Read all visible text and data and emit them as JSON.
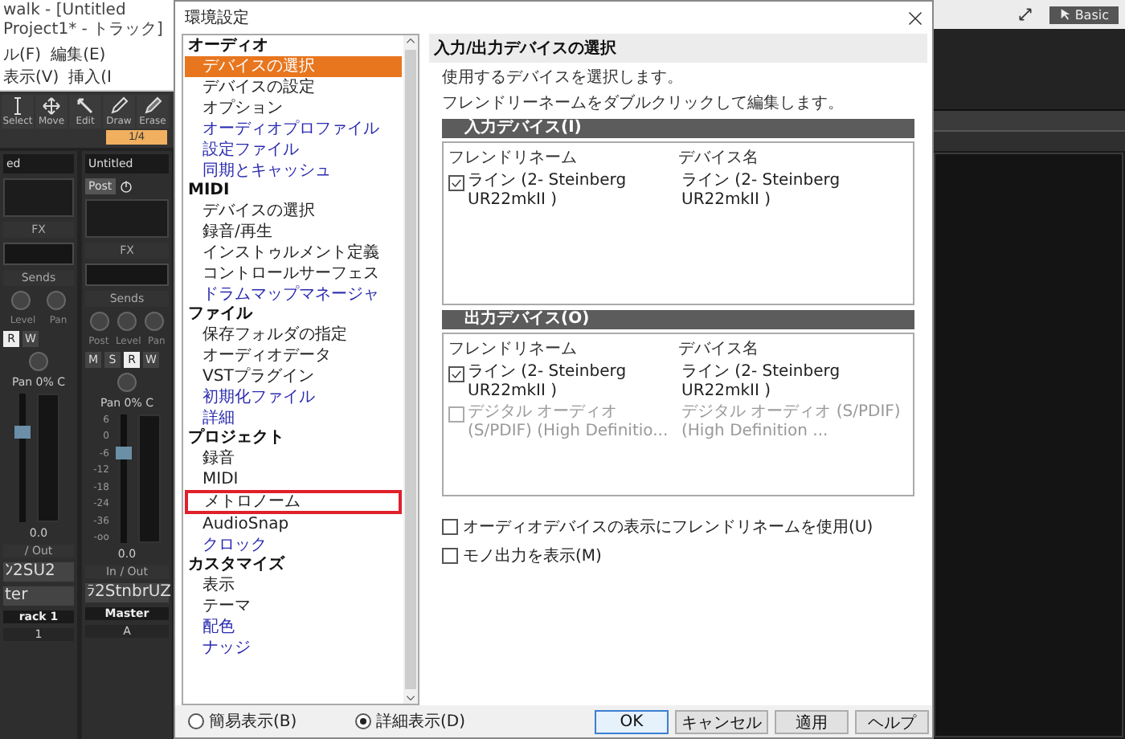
{
  "app": {
    "title": "walk - [Untitled Project1* - トラック]",
    "menu": [
      "ル(F)",
      "編集(E)",
      "表示(V)",
      "挿入(I"
    ],
    "tools": [
      {
        "label": "Select",
        "kind": "ibeam"
      },
      {
        "label": "Move",
        "kind": "move"
      },
      {
        "label": "Edit",
        "kind": "edit"
      },
      {
        "label": "Draw",
        "kind": "draw"
      },
      {
        "label": "Erase",
        "kind": "erase"
      }
    ],
    "snap": "1/4",
    "strips": [
      {
        "name": "ed",
        "fx": "FX",
        "sends": "Sends",
        "send_labels": [
          "Level",
          "Pan"
        ],
        "buttons": [
          {
            "label": "R",
            "on": true
          },
          {
            "label": "W",
            "on": false
          }
        ],
        "pan": "Pan 0% C",
        "value": "0.0",
        "io": "/ Out",
        "input": "ﾝ2SU2",
        "output": "ter",
        "label": "rack 1",
        "number": "1"
      },
      {
        "name": "Untitled",
        "post": "Post",
        "fx": "FX",
        "sends": "Sends",
        "send_labels": [
          "Post",
          "Level",
          "Pan"
        ],
        "buttons": [
          {
            "label": "M",
            "on": false
          },
          {
            "label": "S",
            "on": false
          },
          {
            "label": "R",
            "on": true
          },
          {
            "label": "W",
            "on": false
          }
        ],
        "pan": "Pan 0% C",
        "scale": [
          "6",
          "0",
          "-6",
          "-12",
          "-18",
          "-24",
          "-36",
          "-oo"
        ],
        "value": "0.0",
        "io": "In / Out",
        "input": "ﾗ2StnbrUZ",
        "label": "Master",
        "number": "A"
      }
    ],
    "workspace": "Basic"
  },
  "dialog": {
    "title": "環境設定",
    "tree": [
      {
        "label": "オーディオ",
        "children": [
          {
            "label": "デバイスの選択",
            "selected": true,
            "advanced": false,
            "highlighted": false
          },
          {
            "label": "デバイスの設定",
            "selected": false,
            "advanced": false,
            "highlighted": false
          },
          {
            "label": "オプション",
            "selected": false,
            "advanced": false,
            "highlighted": false
          },
          {
            "label": "オーディオプロファイル",
            "selected": false,
            "advanced": true,
            "highlighted": false
          },
          {
            "label": "設定ファイル",
            "selected": false,
            "advanced": true,
            "highlighted": false
          },
          {
            "label": "同期とキャッシュ",
            "selected": false,
            "advanced": true,
            "highlighted": false
          }
        ]
      },
      {
        "label": "MIDI",
        "children": [
          {
            "label": "デバイスの選択",
            "selected": false,
            "advanced": false,
            "highlighted": false
          },
          {
            "label": "録音/再生",
            "selected": false,
            "advanced": false,
            "highlighted": false
          },
          {
            "label": "インストゥルメント定義",
            "selected": false,
            "advanced": false,
            "highlighted": false
          },
          {
            "label": "コントロールサーフェス",
            "selected": false,
            "advanced": false,
            "highlighted": false
          },
          {
            "label": "ドラムマップマネージャ",
            "selected": false,
            "advanced": true,
            "highlighted": false
          }
        ]
      },
      {
        "label": "ファイル",
        "children": [
          {
            "label": "保存フォルダの指定",
            "selected": false,
            "advanced": false,
            "highlighted": false
          },
          {
            "label": "オーディオデータ",
            "selected": false,
            "advanced": false,
            "highlighted": false
          },
          {
            "label": "VSTプラグイン",
            "selected": false,
            "advanced": false,
            "highlighted": false
          },
          {
            "label": "初期化ファイル",
            "selected": false,
            "advanced": true,
            "highlighted": false
          },
          {
            "label": "詳細",
            "selected": false,
            "advanced": true,
            "highlighted": false
          }
        ]
      },
      {
        "label": "プロジェクト",
        "children": [
          {
            "label": "録音",
            "selected": false,
            "advanced": false,
            "highlighted": false
          },
          {
            "label": "MIDI",
            "selected": false,
            "advanced": false,
            "highlighted": false
          },
          {
            "label": "メトロノーム",
            "selected": false,
            "advanced": false,
            "highlighted": true
          },
          {
            "label": "AudioSnap",
            "selected": false,
            "advanced": false,
            "highlighted": false
          },
          {
            "label": "クロック",
            "selected": false,
            "advanced": true,
            "highlighted": false
          }
        ]
      },
      {
        "label": "カスタマイズ",
        "children": [
          {
            "label": "表示",
            "selected": false,
            "advanced": false,
            "highlighted": false
          },
          {
            "label": "テーマ",
            "selected": false,
            "advanced": false,
            "highlighted": false
          },
          {
            "label": "配色",
            "selected": false,
            "advanced": true,
            "highlighted": false
          },
          {
            "label": "ナッジ",
            "selected": false,
            "advanced": true,
            "highlighted": false
          }
        ]
      }
    ],
    "panel": {
      "title": "入力/出力デバイスの選択",
      "description": [
        "使用するデバイスを選択します。",
        "フレンドリーネームをダブルクリックして編集します。"
      ],
      "sections": [
        {
          "title": "入力デバイス(I)",
          "columns": [
            "フレンドリネーム",
            "デバイス名"
          ],
          "rows": [
            {
              "checked": true,
              "disabled": false,
              "cells": [
                "ライン (2- Steinberg UR22mkII )",
                "ライン (2- Steinberg UR22mkII )"
              ]
            }
          ]
        },
        {
          "title": "出力デバイス(O)",
          "columns": [
            "フレンドリネーム",
            "デバイス名"
          ],
          "rows": [
            {
              "checked": true,
              "disabled": false,
              "cells": [
                "ライン (2- Steinberg UR22mkII )",
                "ライン (2- Steinberg UR22mkII )"
              ]
            },
            {
              "checked": false,
              "disabled": true,
              "cells": [
                "デジタル オーディオ (S/PDIF) (High Definitio...",
                "デジタル オーディオ (S/PDIF) (High Definition ..."
              ]
            }
          ]
        }
      ],
      "options": [
        {
          "label": "オーディオデバイスの表示にフレンドリネームを使用(U)",
          "checked": false
        },
        {
          "label": "モノ出力を表示(M)",
          "checked": false
        }
      ]
    },
    "view_options": [
      {
        "label": "簡易表示(B)",
        "selected": false
      },
      {
        "label": "詳細表示(D)",
        "selected": true
      }
    ],
    "buttons": [
      {
        "label": "OK",
        "default": true
      },
      {
        "label": "キャンセル",
        "default": false
      },
      {
        "label": "適用",
        "default": false
      },
      {
        "label": "ヘルプ",
        "default": false
      }
    ]
  }
}
